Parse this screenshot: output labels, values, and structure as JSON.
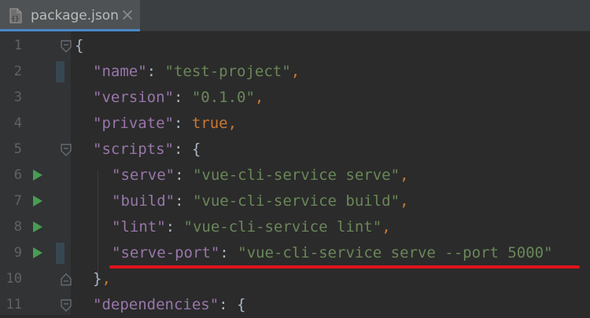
{
  "tab": {
    "title": "package.json",
    "icon": "json-file-icon",
    "close_icon": "close-icon"
  },
  "colors": {
    "accent": "#4a88c7",
    "key": "#9876aa",
    "string": "#6a8759",
    "keyword": "#cc7832",
    "highlight": "#e0121c"
  },
  "lines": [
    {
      "num": "1",
      "open": "{"
    },
    {
      "num": "2",
      "key": "\"name\"",
      "colon": ": ",
      "value": "\"test-project\"",
      "comma": ","
    },
    {
      "num": "3",
      "key": "\"version\"",
      "colon": ": ",
      "value": "\"0.1.0\"",
      "comma": ","
    },
    {
      "num": "4",
      "key": "\"private\"",
      "colon": ": ",
      "kwvalue": "true",
      "comma": ","
    },
    {
      "num": "5",
      "key": "\"scripts\"",
      "colon": ": ",
      "brace": "{"
    },
    {
      "num": "6",
      "key": "\"serve\"",
      "colon": ": ",
      "value": "\"vue-cli-service serve\"",
      "comma": ","
    },
    {
      "num": "7",
      "key": "\"build\"",
      "colon": ": ",
      "value": "\"vue-cli-service build\"",
      "comma": ","
    },
    {
      "num": "8",
      "key": "\"lint\"",
      "colon": ": ",
      "value": "\"vue-cli-service lint\"",
      "comma": ","
    },
    {
      "num": "9",
      "key": "\"serve-port\"",
      "colon": ": ",
      "value": "\"vue-cli-service serve --port 5000\""
    },
    {
      "num": "10",
      "brace": "}",
      "comma": ","
    },
    {
      "num": "11",
      "key": "\"dependencies\"",
      "colon": ": ",
      "brace": "{"
    }
  ]
}
